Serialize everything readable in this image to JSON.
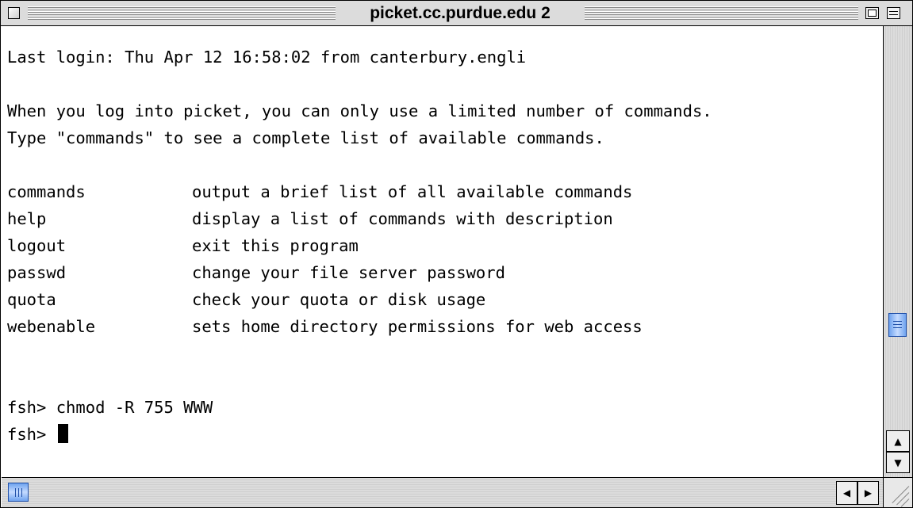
{
  "window": {
    "title": "picket.cc.purdue.edu 2"
  },
  "terminal": {
    "login_line": "Last login: Thu Apr 12 16:58:02 from canterbury.engli",
    "blank_1": "",
    "welcome_line_1": "When you log into picket, you can only use a limited number of commands.",
    "welcome_line_2": "Type \"commands\" to see a complete list of available commands.",
    "blank_2": "",
    "commands": [
      {
        "name": "commands",
        "description": "output a brief list of all available commands"
      },
      {
        "name": "help",
        "description": "display a list of commands with description"
      },
      {
        "name": "logout",
        "description": "exit this program"
      },
      {
        "name": "passwd",
        "description": "change your file server password"
      },
      {
        "name": "quota",
        "description": "check your quota or disk usage"
      },
      {
        "name": "webenable",
        "description": "sets home directory permissions for web access"
      }
    ],
    "history": [
      "fsh> chmod -R 755 WWW"
    ],
    "prompt": "fsh> "
  },
  "scrollbars": {
    "vertical_up_arrow": "▲",
    "vertical_down_arrow": "▼",
    "horizontal_left_arrow": "◀",
    "horizontal_right_arrow": "▶"
  },
  "colors": {
    "thumb_accent": "#6fa3ef",
    "terminal_background": "#ffffff",
    "terminal_text": "#000000"
  }
}
